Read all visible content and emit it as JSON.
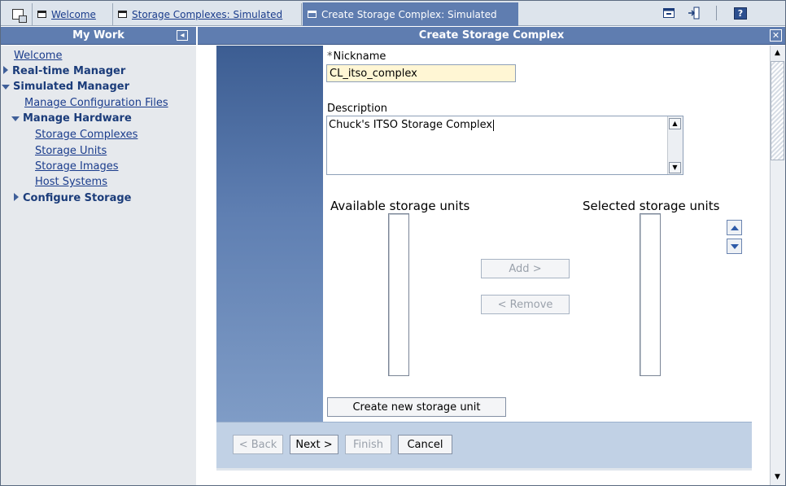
{
  "tabs": {
    "welcome": "Welcome",
    "complexes": "Storage Complexes: Simulated",
    "active": "Create Storage Complex: Simulated"
  },
  "toolbar": {
    "help_label": "?"
  },
  "nav": {
    "title": "My Work",
    "items": {
      "welcome": "Welcome",
      "realtime": "Real-time Manager",
      "simulated": "Simulated Manager",
      "manage_config": "Manage Configuration Files",
      "manage_hardware": "Manage Hardware",
      "storage_complexes": "Storage Complexes",
      "storage_units": "Storage Units",
      "storage_images": "Storage Images",
      "host_systems": "Host Systems",
      "configure_storage": "Configure Storage"
    }
  },
  "main": {
    "title": "Create Storage Complex",
    "nickname_label": "Nickname",
    "nickname_required_mark": "*",
    "nickname_value": "CL_itso_complex",
    "description_label": "Description",
    "description_value": "Chuck's ITSO Storage Complex",
    "available_label": "Available storage units",
    "selected_label": "Selected storage units",
    "add_button": "Add >",
    "remove_button": "< Remove",
    "create_unit_button": "Create new storage unit"
  },
  "wizard": {
    "back": "< Back",
    "next": "Next >",
    "finish": "Finish",
    "cancel": "Cancel"
  },
  "colors": {
    "header_blue": "#5f7db0",
    "nickname_bg": "#fff6d4",
    "footer_band": "#c1d1e5"
  }
}
